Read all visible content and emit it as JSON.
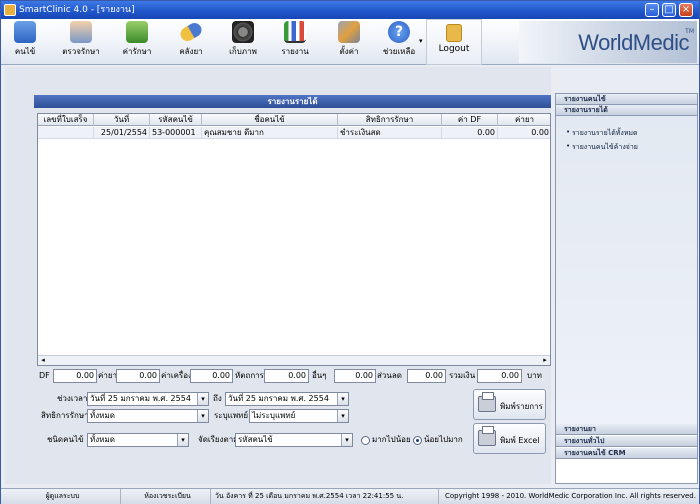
{
  "window": {
    "title": "SmartClinic 4.0 - [รายงาน]"
  },
  "toolbar": {
    "items": [
      {
        "label": "คนไข้",
        "icon": "patient-icon"
      },
      {
        "label": "ตรวจรักษา",
        "icon": "doctor-icon"
      },
      {
        "label": "ค่ารักษา",
        "icon": "money-icon"
      },
      {
        "label": "คลังยา",
        "icon": "medicine-icon"
      },
      {
        "label": "เก็บภาพ",
        "icon": "camera-icon"
      },
      {
        "label": "รายงาน",
        "icon": "report-chart-icon"
      },
      {
        "label": "ตั้งค่า",
        "icon": "settings-tools-icon"
      },
      {
        "label": "ช่วยเหลือ",
        "icon": "help-icon"
      }
    ],
    "logout_label": "Logout",
    "brand": "WorldMedic",
    "brand_tm": "TM"
  },
  "report": {
    "title": "รายงานรายได้",
    "columns": [
      "เลขที่ใบเสร็จ",
      "วันที่",
      "รหัสคนไข้",
      "ชื่อคนไข้",
      "สิทธิการรักษา",
      "ค่า DF",
      "ค่ายา"
    ],
    "rows": [
      [
        "",
        "25/01/2554",
        "53-000001",
        "คุณสมชาย ดีมาก",
        "ชำระเงินสด",
        "0.00",
        "0.00"
      ]
    ]
  },
  "totals": {
    "df_label": "DF",
    "df_value": "0.00",
    "med_label": "ค่ายา",
    "med_value": "0.00",
    "equip_label": "ค่าเครื่อง",
    "equip_value": "0.00",
    "proc_label": "หัตถการ",
    "proc_value": "0.00",
    "other_label": "อื่นๆ",
    "other_value": "0.00",
    "discount_label": "ส่วนลด",
    "discount_value": "0.00",
    "total_label": "รวมเงิน",
    "total_value": "0.00",
    "currency": "บาท"
  },
  "filters": {
    "period_label": "ช่วงเวลา",
    "date_from": "วันที่ 25  มกราคม  พ.ศ.  2554",
    "to_label": "ถึง",
    "date_to": "วันที่ 25  มกราคม  พ.ศ.  2554",
    "right_label": "สิทธิการรักษา",
    "right_value": "ทั้งหมด",
    "doctor_label": "ระบุแพทย์",
    "doctor_value": "ไม่ระบุแพทย์",
    "patient_type_label": "ชนิดคนไข้",
    "patient_type_value": "ทั้งหมด",
    "sort_label": "จัดเรียงตาม",
    "sort_value": "รหัสคนไข้",
    "sort_desc_label": "มากไปน้อย",
    "sort_asc_label": "น้อยไปมาก"
  },
  "actions": {
    "print_label": "พิมพ์รายการ",
    "excel_label": "พิมพ์ Excel"
  },
  "sidebar": {
    "header_patient": "รายงานคนไข้",
    "header_income": "รายงานรายได้",
    "items": [
      "รายงานรายได้ทั้งหมด",
      "รายงานคนไข้ค้างจ่าย"
    ],
    "footer": [
      "รายงานยา",
      "รายงานทั่วไป",
      "รายงานคนไข้ CRM"
    ]
  },
  "status": {
    "user": "ผู้ดูแลระบบ",
    "room": "ห้องเวชระเบียน",
    "datetime": "วัน อังคาร ที่ 25 เดือน มกราคม พ.ศ.2554 เวลา 22:41:55 น.",
    "copyright": "Copyright 1998 - 2010. WorldMedic Corporation Inc. All rights reserved."
  }
}
